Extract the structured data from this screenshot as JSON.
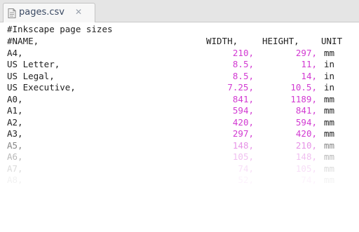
{
  "tab": {
    "label": "pages.csv",
    "close_glyph": "✕",
    "icon": "text-file-icon"
  },
  "lines": {
    "l0": "#Inkscape page sizes",
    "l1": {
      "name": "#NAME,",
      "width": "WIDTH,",
      "height": "HEIGHT,",
      "unit": "UNIT"
    },
    "l2": {
      "name": "A4,",
      "width": "210,",
      "height": "297,",
      "unit": "mm"
    },
    "l3": {
      "name": "US Letter,",
      "width": "8.5,",
      "height": "11,",
      "unit": "in"
    },
    "l4": {
      "name": "US Legal,",
      "width": "8.5,",
      "height": "14,",
      "unit": "in"
    },
    "l5": {
      "name": "US Executive,",
      "width": "7.25,",
      "height": "10.5,",
      "unit": "in"
    },
    "l6": {
      "name": "A0,",
      "width": "841,",
      "height": "1189,",
      "unit": "mm"
    },
    "l7": {
      "name": "A1,",
      "width": "594,",
      "height": "841,",
      "unit": "mm"
    },
    "l8": {
      "name": "A2,",
      "width": "420,",
      "height": "594,",
      "unit": "mm"
    },
    "l9": {
      "name": "A3,",
      "width": "297,",
      "height": "420,",
      "unit": "mm"
    },
    "l10": {
      "name": "A5,",
      "width": "148,",
      "height": "210,",
      "unit": "mm"
    },
    "l11": {
      "name": "A6,",
      "width": "105,",
      "height": "148,",
      "unit": "mm"
    },
    "l12": {
      "name": "A7,",
      "width": "74,",
      "height": "105,",
      "unit": "mm"
    },
    "l13": {
      "name": "A8,",
      "width": "52,",
      "height": "74,",
      "unit": "mm"
    }
  },
  "colors": {
    "number": "#d23ad2",
    "text": "#222222",
    "tab_text": "#3b4a63"
  }
}
